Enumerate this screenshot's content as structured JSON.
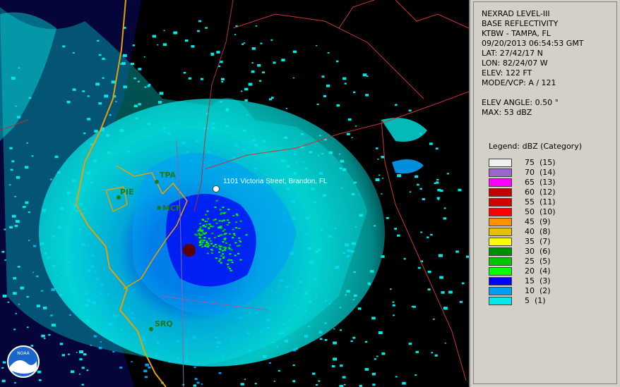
{
  "info": {
    "lines": [
      "NEXRAD LEVEL-III",
      "BASE REFLECTIVITY",
      "KTBW - TAMPA, FL",
      "09/20/2013 06:54:53 GMT",
      "LAT: 27/42/17 N",
      "LON: 82/24/07 W",
      "ELEV: 122 FT",
      "MODE/VCP: A / 121"
    ],
    "elev_angle": "ELEV ANGLE: 0.50 °",
    "max": "MAX: 53 dBZ"
  },
  "legend": {
    "title": "Legend: dBZ (Category)",
    "entries": [
      {
        "label": "75  (15)",
        "color": "#f0f0f0"
      },
      {
        "label": "70  (14)",
        "color": "#9966cc"
      },
      {
        "label": "65  (13)",
        "color": "#ff00ff"
      },
      {
        "label": "60  (12)",
        "color": "#c00000"
      },
      {
        "label": "55  (11)",
        "color": "#d00000"
      },
      {
        "label": "50  (10)",
        "color": "#ff0000"
      },
      {
        "label": "45  (9)",
        "color": "#ff9000"
      },
      {
        "label": "40  (8)",
        "color": "#e7c000"
      },
      {
        "label": "35  (7)",
        "color": "#ffff00"
      },
      {
        "label": "30  (6)",
        "color": "#008e00"
      },
      {
        "label": "25  (5)",
        "color": "#00c800"
      },
      {
        "label": "20  (4)",
        "color": "#00ff00"
      },
      {
        "label": "15  (3)",
        "color": "#0000f6"
      },
      {
        "label": "10  (2)",
        "color": "#019ff4"
      },
      {
        "label": "5  (1)",
        "color": "#04e9e7"
      }
    ]
  },
  "map": {
    "cities": [
      "TPA",
      "PIE",
      "MCF",
      "SRQ"
    ],
    "marker_label": "1101 Victoria Street, Brandon, FL",
    "logo": "NOAA"
  }
}
